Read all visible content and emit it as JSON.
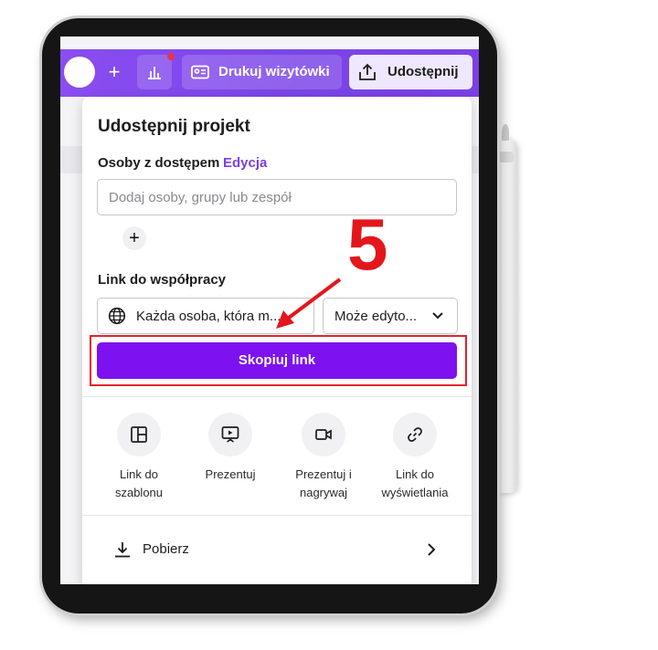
{
  "colors": {
    "accent": "#7d11f0",
    "brand_bar": "#8a4df0",
    "annotation": "#e4161c",
    "edit_link": "#7b3fe4"
  },
  "topbar": {
    "avatar_icon": "avatar",
    "add_icon": "+",
    "stats_icon": "bar-chart-icon",
    "print_label": "Drukuj wizytówki",
    "share_label": "Udostępnij"
  },
  "share_panel": {
    "title": "Udostępnij projekt",
    "access_label": "Osoby z dostępem",
    "edit_label": "Edycja",
    "people_input": {
      "placeholder": "Dodaj osoby, grupy lub zespół",
      "value": ""
    },
    "add_icon": "+",
    "collab_link_label": "Link do współpracy",
    "access_select": "Każda osoba, która m...",
    "permission_select": "Może edyto...",
    "copy_button": "Skopiuj link",
    "options": [
      {
        "icon": "template-icon",
        "label_line1": "Link do",
        "label_line2": "szablonu"
      },
      {
        "icon": "present-icon",
        "label_line1": "Prezentuj",
        "label_line2": ""
      },
      {
        "icon": "camera-icon",
        "label_line1": "Prezentuj i",
        "label_line2": "nagrywaj"
      },
      {
        "icon": "link-icon",
        "label_line1": "Link do",
        "label_line2": "wyświetlania"
      }
    ],
    "download_label": "Pobierz"
  },
  "annotation": {
    "step_number": "5"
  }
}
